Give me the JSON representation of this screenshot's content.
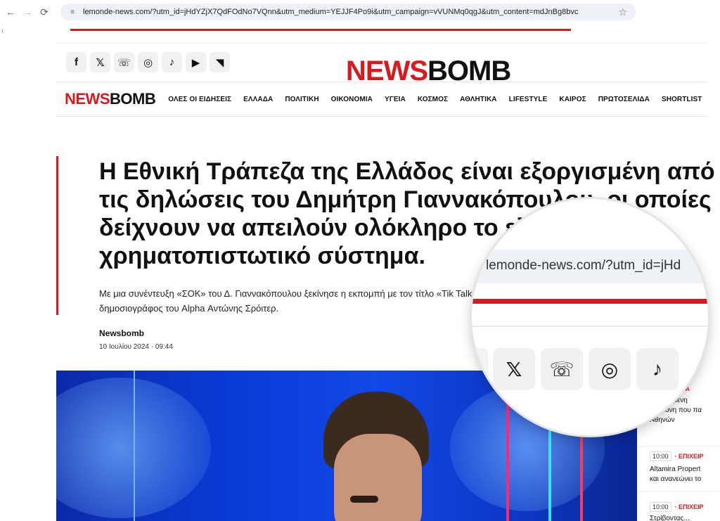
{
  "browser": {
    "url": "lemonde-news.com/?utm_id=jHdYZjX7QdFOdNo7VQnn&utm_medium=YEJJF4Po9i&utm_campaign=vVUNMq0qgJ&utm_content=mdJnBg8bvc",
    "back_glyph": "←",
    "forward_glyph": "→",
    "reload_glyph": "⟳",
    "site_info_glyph": "≡",
    "star_glyph": "☆"
  },
  "site": {
    "logo_news": "NEWS",
    "logo_bomb": "BOMB",
    "socials": [
      {
        "icon": "facebook-icon",
        "glyph": "f"
      },
      {
        "icon": "x-icon",
        "glyph": "𝕏"
      },
      {
        "icon": "viber-icon",
        "glyph": "☏"
      },
      {
        "icon": "instagram-icon",
        "glyph": "◎"
      },
      {
        "icon": "tiktok-icon",
        "glyph": "♪"
      },
      {
        "icon": "youtube-icon",
        "glyph": "▶"
      },
      {
        "icon": "rss-icon",
        "glyph": "◥"
      }
    ],
    "nav": [
      "ΟΛΕΣ ΟΙ ΕΙΔΗΣΕΙΣ",
      "ΕΛΛΑΔΑ",
      "ΠΟΛΙΤΙΚΗ",
      "ΟΙΚΟΝΟΜΙΑ",
      "ΥΓΕΙΑ",
      "ΚΟΣΜΟΣ",
      "ΑΘΛΗΤΙΚΑ",
      "LIFESTYLE",
      "ΚΑΙΡΟΣ",
      "ΠΡΩΤΟΣΕΛΙΔΑ",
      "SHORTLIST"
    ]
  },
  "article": {
    "headline": "Η Εθνική Τράπεζα της Ελλάδος είναι εξοργισμένη από τις δηλώσεις του Δημήτρη Γιαννακόπουλου, οι οποίες δείχνουν να απειλούν ολόκληρο το ελληνικό χρηματοπιστωτικό σύστημα.",
    "lede": "Με μια συνέντευξη «ΣΟΚ» του Δ. Γιαννακόπουλου ξεκίνησε η εκπομπή με τον τίτλο «Tik Talk», ο δημοσιογράφος του Alpha Αντώνης Σρόιτερ.",
    "author": "Newsbomb",
    "date": "10 Ιουλίου 2024 · 09:44"
  },
  "sidebar": {
    "items": [
      {
        "time": "",
        "category": "· ΕΛΛΑΔΑ",
        "title_line1": "Αγνοούμενη",
        "title_line2": "17χρονη που πα",
        "title_line3": "Αθηνών"
      },
      {
        "time": "10:00",
        "category": "· ΕΠΙΧΕΙΡ",
        "title_line1": "Altamira Propert",
        "title_line2": "και ανανεώνει το"
      },
      {
        "time": "10:00",
        "category": "· ΕΠΙΧΕΙΡ",
        "title_line1": "Στρίβοντας..."
      }
    ]
  },
  "magnifier": {
    "url": "lemonde-news.com/?utm_id=jHd",
    "socials": [
      {
        "icon": "x-icon",
        "glyph": "𝕏"
      },
      {
        "icon": "viber-icon",
        "glyph": "☏"
      },
      {
        "icon": "instagram-icon",
        "glyph": "◎"
      },
      {
        "icon": "tiktok-icon",
        "glyph": "♪"
      }
    ]
  }
}
